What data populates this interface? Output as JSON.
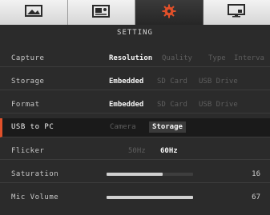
{
  "tabs": [
    {
      "name": "image-icon",
      "active": false
    },
    {
      "name": "video-icon",
      "active": false
    },
    {
      "name": "gear-icon",
      "active": true
    },
    {
      "name": "monitor-icon",
      "active": false
    }
  ],
  "title": "SETTING",
  "accent": "#e0502a",
  "rows": {
    "capture": {
      "label": "Capture",
      "options": [
        "Resolution",
        "Quality",
        "Type",
        "Interva"
      ],
      "selected": "Resolution"
    },
    "storage": {
      "label": "Storage",
      "options": [
        "Embedded",
        "SD Card",
        "USB Drive"
      ],
      "selected": "Embedded"
    },
    "format": {
      "label": "Format",
      "options": [
        "Embedded",
        "SD Card",
        "USB Drive"
      ],
      "selected": "Embedded"
    },
    "usb": {
      "label": "USB to PC",
      "options": [
        "Camera",
        "Storage"
      ],
      "selected": "Storage"
    },
    "flicker": {
      "label": "Flicker",
      "options": [
        "50Hz",
        "60Hz"
      ],
      "selected": "60Hz"
    },
    "saturation": {
      "label": "Saturation",
      "value": "16",
      "level": 0.65
    },
    "mic": {
      "label": "Mic Volume",
      "value": "67",
      "level": 1.0
    }
  }
}
